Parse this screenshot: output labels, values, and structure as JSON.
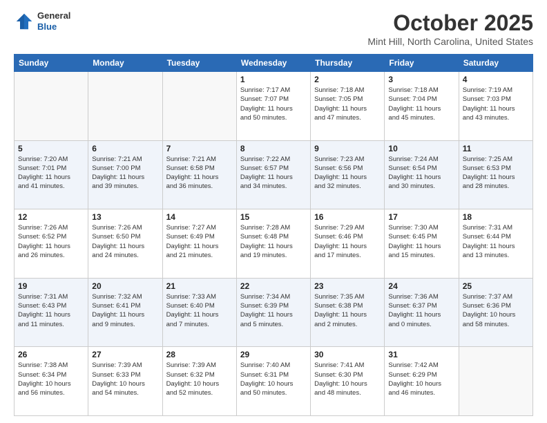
{
  "header": {
    "logo": {
      "general": "General",
      "blue": "Blue"
    },
    "title": "October 2025",
    "location": "Mint Hill, North Carolina, United States"
  },
  "weekdays": [
    "Sunday",
    "Monday",
    "Tuesday",
    "Wednesday",
    "Thursday",
    "Friday",
    "Saturday"
  ],
  "weeks": [
    [
      {
        "date": "",
        "info": ""
      },
      {
        "date": "",
        "info": ""
      },
      {
        "date": "",
        "info": ""
      },
      {
        "date": "1",
        "info": "Sunrise: 7:17 AM\nSunset: 7:07 PM\nDaylight: 11 hours\nand 50 minutes."
      },
      {
        "date": "2",
        "info": "Sunrise: 7:18 AM\nSunset: 7:05 PM\nDaylight: 11 hours\nand 47 minutes."
      },
      {
        "date": "3",
        "info": "Sunrise: 7:18 AM\nSunset: 7:04 PM\nDaylight: 11 hours\nand 45 minutes."
      },
      {
        "date": "4",
        "info": "Sunrise: 7:19 AM\nSunset: 7:03 PM\nDaylight: 11 hours\nand 43 minutes."
      }
    ],
    [
      {
        "date": "5",
        "info": "Sunrise: 7:20 AM\nSunset: 7:01 PM\nDaylight: 11 hours\nand 41 minutes."
      },
      {
        "date": "6",
        "info": "Sunrise: 7:21 AM\nSunset: 7:00 PM\nDaylight: 11 hours\nand 39 minutes."
      },
      {
        "date": "7",
        "info": "Sunrise: 7:21 AM\nSunset: 6:58 PM\nDaylight: 11 hours\nand 36 minutes."
      },
      {
        "date": "8",
        "info": "Sunrise: 7:22 AM\nSunset: 6:57 PM\nDaylight: 11 hours\nand 34 minutes."
      },
      {
        "date": "9",
        "info": "Sunrise: 7:23 AM\nSunset: 6:56 PM\nDaylight: 11 hours\nand 32 minutes."
      },
      {
        "date": "10",
        "info": "Sunrise: 7:24 AM\nSunset: 6:54 PM\nDaylight: 11 hours\nand 30 minutes."
      },
      {
        "date": "11",
        "info": "Sunrise: 7:25 AM\nSunset: 6:53 PM\nDaylight: 11 hours\nand 28 minutes."
      }
    ],
    [
      {
        "date": "12",
        "info": "Sunrise: 7:26 AM\nSunset: 6:52 PM\nDaylight: 11 hours\nand 26 minutes."
      },
      {
        "date": "13",
        "info": "Sunrise: 7:26 AM\nSunset: 6:50 PM\nDaylight: 11 hours\nand 24 minutes."
      },
      {
        "date": "14",
        "info": "Sunrise: 7:27 AM\nSunset: 6:49 PM\nDaylight: 11 hours\nand 21 minutes."
      },
      {
        "date": "15",
        "info": "Sunrise: 7:28 AM\nSunset: 6:48 PM\nDaylight: 11 hours\nand 19 minutes."
      },
      {
        "date": "16",
        "info": "Sunrise: 7:29 AM\nSunset: 6:46 PM\nDaylight: 11 hours\nand 17 minutes."
      },
      {
        "date": "17",
        "info": "Sunrise: 7:30 AM\nSunset: 6:45 PM\nDaylight: 11 hours\nand 15 minutes."
      },
      {
        "date": "18",
        "info": "Sunrise: 7:31 AM\nSunset: 6:44 PM\nDaylight: 11 hours\nand 13 minutes."
      }
    ],
    [
      {
        "date": "19",
        "info": "Sunrise: 7:31 AM\nSunset: 6:43 PM\nDaylight: 11 hours\nand 11 minutes."
      },
      {
        "date": "20",
        "info": "Sunrise: 7:32 AM\nSunset: 6:41 PM\nDaylight: 11 hours\nand 9 minutes."
      },
      {
        "date": "21",
        "info": "Sunrise: 7:33 AM\nSunset: 6:40 PM\nDaylight: 11 hours\nand 7 minutes."
      },
      {
        "date": "22",
        "info": "Sunrise: 7:34 AM\nSunset: 6:39 PM\nDaylight: 11 hours\nand 5 minutes."
      },
      {
        "date": "23",
        "info": "Sunrise: 7:35 AM\nSunset: 6:38 PM\nDaylight: 11 hours\nand 2 minutes."
      },
      {
        "date": "24",
        "info": "Sunrise: 7:36 AM\nSunset: 6:37 PM\nDaylight: 11 hours\nand 0 minutes."
      },
      {
        "date": "25",
        "info": "Sunrise: 7:37 AM\nSunset: 6:36 PM\nDaylight: 10 hours\nand 58 minutes."
      }
    ],
    [
      {
        "date": "26",
        "info": "Sunrise: 7:38 AM\nSunset: 6:34 PM\nDaylight: 10 hours\nand 56 minutes."
      },
      {
        "date": "27",
        "info": "Sunrise: 7:39 AM\nSunset: 6:33 PM\nDaylight: 10 hours\nand 54 minutes."
      },
      {
        "date": "28",
        "info": "Sunrise: 7:39 AM\nSunset: 6:32 PM\nDaylight: 10 hours\nand 52 minutes."
      },
      {
        "date": "29",
        "info": "Sunrise: 7:40 AM\nSunset: 6:31 PM\nDaylight: 10 hours\nand 50 minutes."
      },
      {
        "date": "30",
        "info": "Sunrise: 7:41 AM\nSunset: 6:30 PM\nDaylight: 10 hours\nand 48 minutes."
      },
      {
        "date": "31",
        "info": "Sunrise: 7:42 AM\nSunset: 6:29 PM\nDaylight: 10 hours\nand 46 minutes."
      },
      {
        "date": "",
        "info": ""
      }
    ]
  ]
}
